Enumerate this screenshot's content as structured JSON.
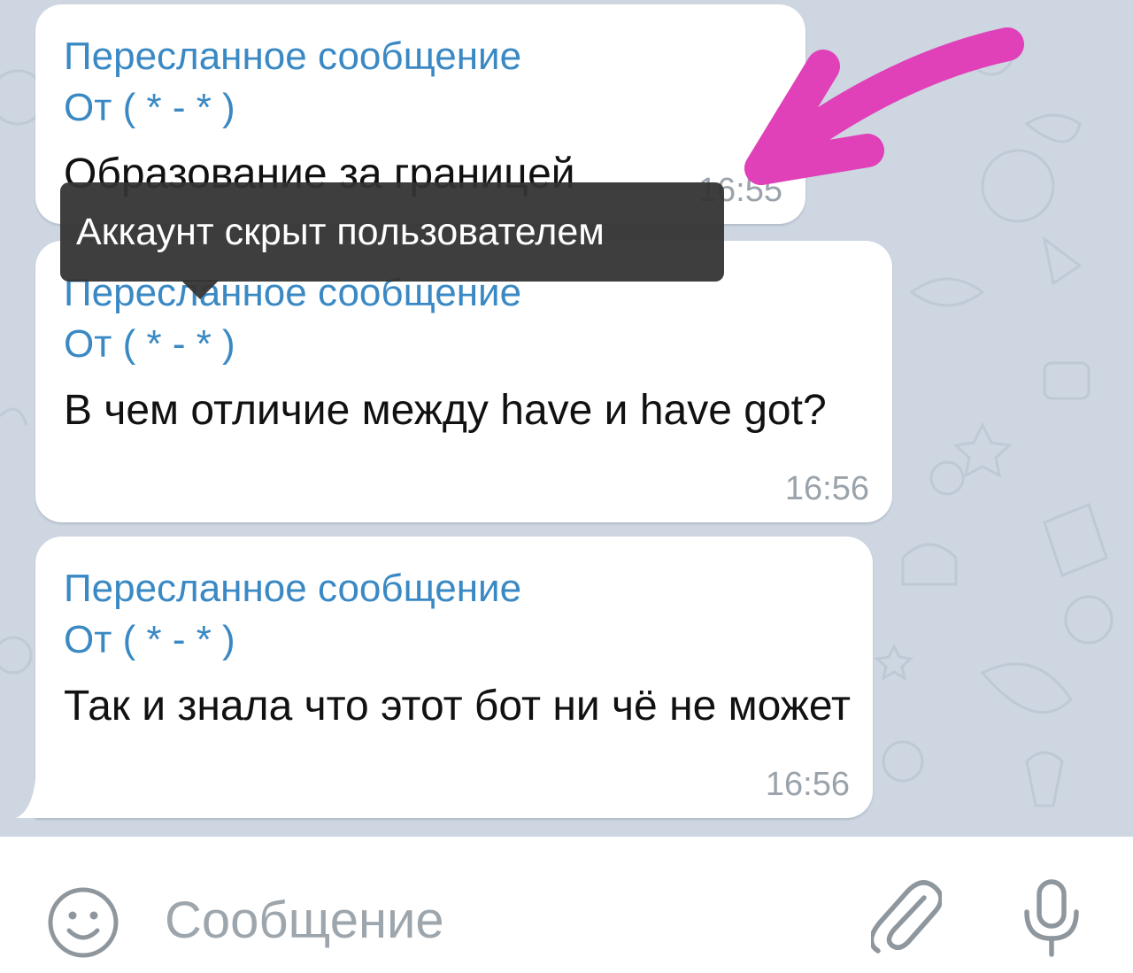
{
  "messages": [
    {
      "forward_label": "Пересланное сообщение",
      "from": "От ( * - * )",
      "text": "Образование за границей",
      "time": "16:55"
    },
    {
      "forward_label": "Пересланное сообщение",
      "from": "От ( * - * )",
      "text": "В чем отличие между have и have got?",
      "time": "16:56"
    },
    {
      "forward_label": "Пересланное сообщение",
      "from": "От ( * - * )",
      "text": "Так и знала что этот бот ни чё не может",
      "time": "16:56"
    }
  ],
  "tooltip": {
    "text": "Аккаунт скрыт пользователем"
  },
  "annotation": {
    "arrow_color": "#e040b8"
  },
  "composer": {
    "placeholder": "Сообщение"
  },
  "icons": {
    "emoji": "smiley-icon",
    "attach": "paperclip-icon",
    "mic": "microphone-icon"
  },
  "colors": {
    "forward": "#3a89c4",
    "background": "#cdd6e1",
    "bubble": "#ffffff"
  }
}
